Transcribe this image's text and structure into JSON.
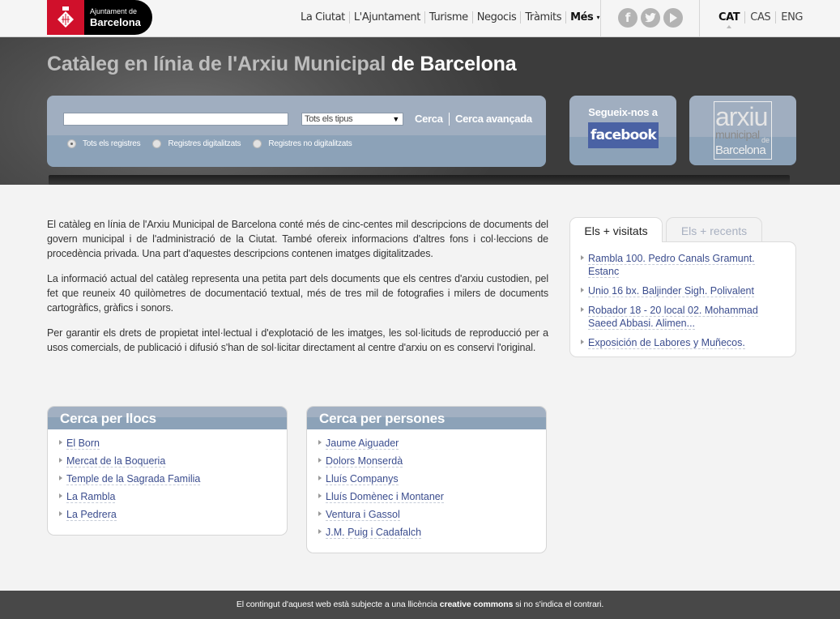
{
  "header": {
    "logo": {
      "line1": "Ajuntament de",
      "line2": "Barcelona"
    },
    "nav": [
      {
        "label": "La Ciutat"
      },
      {
        "label": "L'Ajuntament"
      },
      {
        "label": "Turisme"
      },
      {
        "label": "Negocis"
      },
      {
        "label": "Tràmits"
      },
      {
        "label": "Més",
        "caret": "▾"
      }
    ],
    "social": [
      {
        "name": "facebook-icon",
        "glyph": "f"
      },
      {
        "name": "twitter-icon",
        "glyph": "t"
      },
      {
        "name": "youtube-icon",
        "glyph": "▶"
      }
    ],
    "languages": [
      {
        "label": "CAT",
        "active": true
      },
      {
        "label": "CAS"
      },
      {
        "label": "ENG"
      }
    ]
  },
  "hero": {
    "title_light": "Catàleg en línia de l'Arxiu Municipal",
    "title_strong": "de Barcelona",
    "search": {
      "input_value": "",
      "type_selected": "Tots els tipus",
      "type_arrow": "▼",
      "search_label": "Cerca",
      "advanced_label": "Cerca avançada",
      "radios": [
        {
          "label": "Tots els registres",
          "checked": true
        },
        {
          "label": "Registres digitalitzats",
          "checked": false
        },
        {
          "label": "Registres no digitalitzats",
          "checked": false
        }
      ]
    },
    "facebook": {
      "label": "Segueix-nos a",
      "brand": "facebook"
    },
    "arxiu_logo": {
      "line1": "arxiu",
      "line2": "municipal",
      "line3": "de",
      "line4": "Barcelona"
    }
  },
  "intro": {
    "paragraphs": [
      "El catàleg en línia de l'Arxiu Municipal de Barcelona conté més de cinc-centes mil descripcions de documents del govern municipal i de l'administració de la Ciutat. També ofereix informacions d'altres fons i col·leccions de procedència privada. Una part d'aquestes descripcions contenen imatges digitalitzades.",
      "La informació actual del catàleg representa una petita part dels documents que els centres d'arxiu custodien, pel fet que reuneix 40 quilòmetres de documentació textual, més de tres mil de fotografies i milers de documents cartogràfics, gràfics i sonors.",
      "Per garantir els drets de propietat intel·lectual i d'explotació de les imatges, les sol·licituds de reproducció per a usos comercials, de publicació i difusió s'han de sol·licitar directament al centre d'arxiu on es conservi l'original."
    ]
  },
  "tabs": {
    "items": [
      {
        "label": "Els + visitats",
        "active": true
      },
      {
        "label": "Els + recents",
        "active": false
      }
    ],
    "links": [
      {
        "label": "Rambla 100. Pedro Canals Gramunt. Estanc"
      },
      {
        "label": "Unio 16 bx. Baljinder Sigh. Polivalent"
      },
      {
        "label": "Robador 18 - 20 local 02. Mohammad Saeed Abbasi. Alimen..."
      },
      {
        "label": "Exposición de Labores y Muñecos."
      }
    ]
  },
  "places": {
    "title": "Cerca per llocs",
    "links": [
      {
        "label": "El Born"
      },
      {
        "label": "Mercat de la Boqueria"
      },
      {
        "label": "Temple de la Sagrada Familia"
      },
      {
        "label": "La Rambla"
      },
      {
        "label": "La Pedrera"
      }
    ]
  },
  "people": {
    "title": "Cerca per persones",
    "links": [
      {
        "label": "Jaume Aiguader"
      },
      {
        "label": "Dolors Monserdà"
      },
      {
        "label": "Lluís Companys"
      },
      {
        "label": "Lluís Domènec i Montaner"
      },
      {
        "label": "Ventura i Gassol"
      },
      {
        "label": "J.M. Puig i Cadafalch"
      }
    ]
  },
  "footer": {
    "text_before": "El contingut d'aquest web està subjecte a una llicència ",
    "text_bold": "creative commons",
    "text_after": " si no s'indica el contrari."
  },
  "colors": {
    "brand_red": "#d0102b",
    "panel_blue": "#8ca2b8",
    "link_blue": "#3b4d8e",
    "facebook_blue": "#4a62a4",
    "footer_bg": "#484848"
  }
}
